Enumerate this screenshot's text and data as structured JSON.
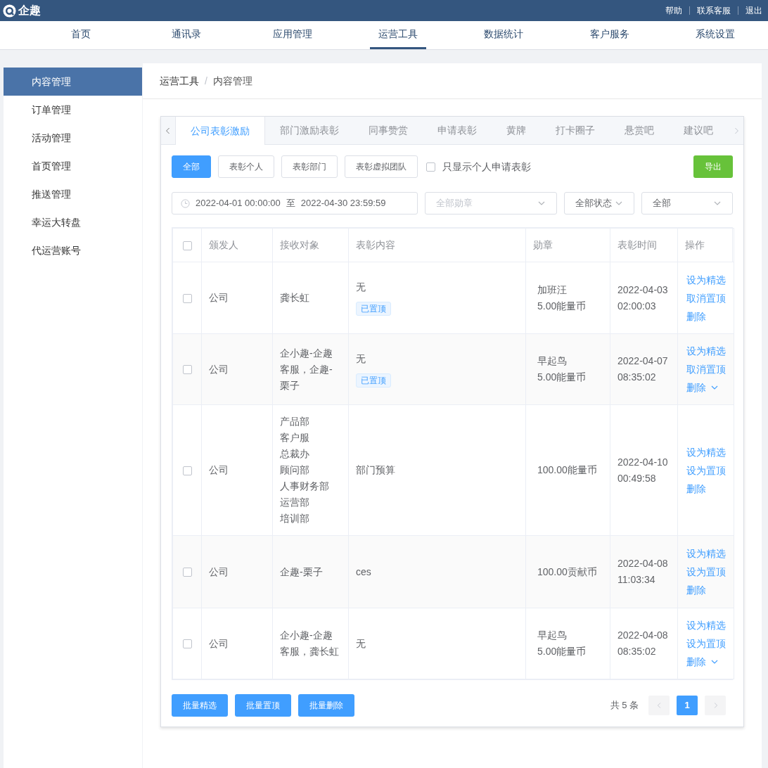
{
  "header": {
    "logo_text": "企趣",
    "links": [
      "帮助",
      "联系客服",
      "退出"
    ]
  },
  "nav": [
    {
      "label": "首页",
      "selected": false
    },
    {
      "label": "通讯录",
      "selected": false
    },
    {
      "label": "应用管理",
      "selected": false
    },
    {
      "label": "运营工具",
      "selected": true
    },
    {
      "label": "数据统计",
      "selected": false
    },
    {
      "label": "客户服务",
      "selected": false
    },
    {
      "label": "系统设置",
      "selected": false
    }
  ],
  "sidebar": {
    "items": [
      {
        "label": "内容管理",
        "selected": true
      },
      {
        "label": "订单管理",
        "selected": false
      },
      {
        "label": "活动管理",
        "selected": false
      },
      {
        "label": "首页管理",
        "selected": false
      },
      {
        "label": "推送管理",
        "selected": false
      },
      {
        "label": "幸运大转盘",
        "selected": false
      },
      {
        "label": "代运营账号",
        "selected": false
      }
    ]
  },
  "breadcrumb": [
    "运营工具",
    "内容管理"
  ],
  "breadcrumb_separator": "/",
  "tabs": [
    {
      "label": "公司表彰激励",
      "selected": true
    },
    {
      "label": "部门激励表彰",
      "selected": false
    },
    {
      "label": "同事赞赏",
      "selected": false
    },
    {
      "label": "申请表彰",
      "selected": false
    },
    {
      "label": "黄牌",
      "selected": false
    },
    {
      "label": "打卡圈子",
      "selected": false
    },
    {
      "label": "悬赏吧",
      "selected": false
    },
    {
      "label": "建议吧",
      "selected": false
    }
  ],
  "filter_buttons": [
    {
      "label": "全部",
      "selected": true
    },
    {
      "label": "表彰个人",
      "selected": false
    },
    {
      "label": "表彰部门",
      "selected": false
    },
    {
      "label": "表彰虚拟团队",
      "selected": false
    }
  ],
  "only_personal": {
    "label": "只显示个人申请表彰",
    "checked": false
  },
  "export_button": "导出",
  "date_range": {
    "start": "2022-04-01 00:00:00",
    "separator": "至",
    "end": "2022-04-30 23:59:59"
  },
  "selects": [
    {
      "placeholder": "全部勋章"
    },
    {
      "value": "全部状态"
    },
    {
      "value": "全部"
    }
  ],
  "table": {
    "select_all_checked": false,
    "columns": [
      "颁发人",
      "接收对象",
      "表彰内容",
      "勋章",
      "表彰时间",
      "操作"
    ],
    "rows": [
      {
        "checked": false,
        "issuer": "公司",
        "receivers": [
          "龚长虹"
        ],
        "content": "无",
        "pinned_tag": "已置顶",
        "medal": [
          "加班汪",
          "5.00能量币"
        ],
        "time": [
          "2022-04-03",
          "02:00:03"
        ],
        "actions": [
          {
            "label": "设为精选"
          },
          {
            "label": "取消置顶"
          },
          {
            "label": "删除",
            "has_menu": false
          }
        ]
      },
      {
        "checked": false,
        "issuer": "公司",
        "receivers": [
          "企小趣-企趣",
          "客服，企趣-",
          "栗子"
        ],
        "content": "无",
        "pinned_tag": "已置顶",
        "medal": [
          "早起鸟",
          "5.00能量币"
        ],
        "time": [
          "2022-04-07",
          "08:35:02"
        ],
        "actions": [
          {
            "label": "设为精选"
          },
          {
            "label": "取消置顶"
          },
          {
            "label": "删除",
            "has_menu": true
          }
        ]
      },
      {
        "checked": false,
        "issuer": "公司",
        "receivers": [
          "产品部",
          "客户服",
          "总裁办",
          "顾问部",
          "人事财务部",
          "运营部",
          "培训部"
        ],
        "content": "部门预算",
        "medal": [
          "100.00能量币"
        ],
        "time": [
          "2022-04-10",
          "00:49:58"
        ],
        "actions": [
          {
            "label": "设为精选"
          },
          {
            "label": "设为置顶"
          },
          {
            "label": "删除",
            "has_menu": false
          }
        ]
      },
      {
        "checked": false,
        "issuer": "公司",
        "receivers": [
          "企趣-栗子"
        ],
        "content": "ces",
        "medal": [
          "100.00贡献币"
        ],
        "time": [
          "2022-04-08",
          "11:03:34"
        ],
        "actions": [
          {
            "label": "设为精选"
          },
          {
            "label": "设为置顶"
          },
          {
            "label": "删除",
            "has_menu": false
          }
        ]
      },
      {
        "checked": false,
        "issuer": "公司",
        "receivers": [
          "企小趣-企趣",
          "客服，龚长虹"
        ],
        "content": "无",
        "medal": [
          "早起鸟",
          "5.00能量币"
        ],
        "time": [
          "2022-04-08",
          "08:35:02"
        ],
        "actions": [
          {
            "label": "设为精选"
          },
          {
            "label": "设为置顶"
          },
          {
            "label": "删除",
            "has_menu": true
          }
        ]
      }
    ]
  },
  "batch_buttons": [
    "批量精选",
    "批量置顶",
    "批量删除"
  ],
  "pagination": {
    "total": "共 5 条",
    "pages": [
      {
        "label": "1",
        "selected": true
      }
    ]
  }
}
